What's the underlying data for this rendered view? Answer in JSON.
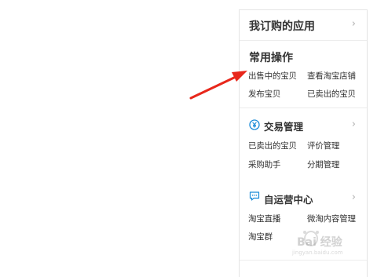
{
  "panel": {
    "subscribed_apps": {
      "title": "我订购的应用",
      "chevron": "›"
    },
    "common_ops": {
      "title": "常用操作",
      "links": [
        "出售中的宝贝",
        "查看淘宝店铺",
        "发布宝贝",
        "已卖出的宝贝"
      ]
    },
    "trade_mgmt": {
      "icon": "yuan-circle-icon",
      "title": "交易管理",
      "chevron": "›",
      "links": [
        "已卖出的宝贝",
        "评价管理",
        "采购助手",
        "分期管理"
      ]
    },
    "self_ops": {
      "icon": "chat-bubble-icon",
      "title": "自运营中心",
      "chevron": "›",
      "links": [
        "淘宝直播",
        "微淘内容管理",
        "淘宝群"
      ]
    }
  },
  "annotation": {
    "color": "#e8271b"
  },
  "watermark": {
    "brand": "Bai 经验",
    "url": "jingyan.baidu.com"
  },
  "colors": {
    "accent": "#1a8bd8",
    "text": "#333333",
    "border": "#e4e4e4"
  }
}
